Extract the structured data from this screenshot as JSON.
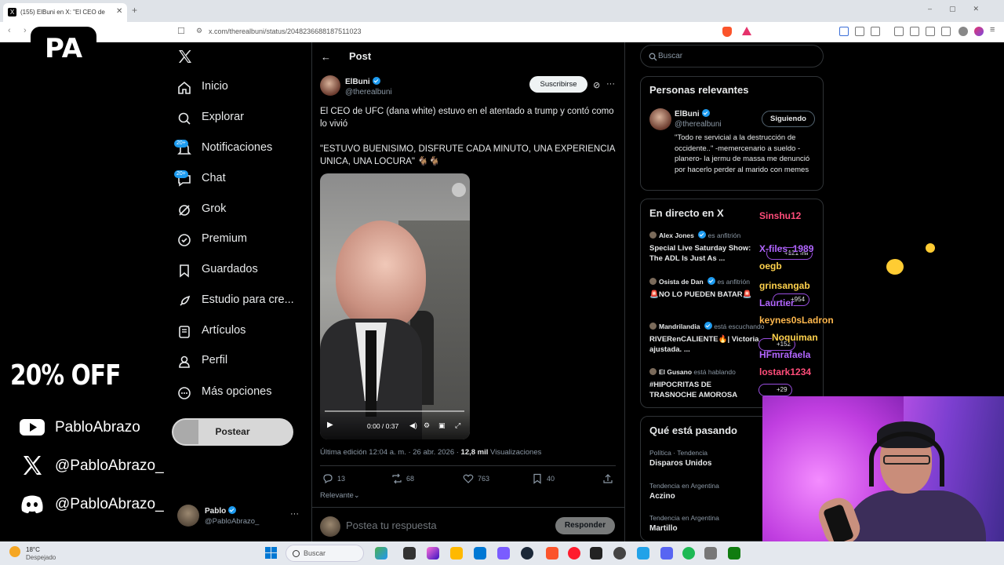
{
  "browser": {
    "tab_title": "(155) ElBuni en X: \"El CEO de U",
    "url": "x.com/therealbuni/status/2048236688187511023"
  },
  "overlay": {
    "logo": "PA",
    "promo": "20% OFF",
    "socials": [
      {
        "icon": "youtube-icon",
        "label": "PabloAbrazo"
      },
      {
        "icon": "x-icon",
        "label": "@PabloAbrazo_"
      },
      {
        "icon": "discord-icon",
        "label": "@PabloAbrazo_"
      }
    ]
  },
  "sidebar": {
    "items": [
      {
        "label": "Inicio",
        "icon": "home-icon"
      },
      {
        "label": "Explorar",
        "icon": "search-icon"
      },
      {
        "label": "Notificaciones",
        "icon": "bell-icon",
        "badge": "20+"
      },
      {
        "label": "Chat",
        "icon": "chat-icon",
        "badge": "20+"
      },
      {
        "label": "Grok",
        "icon": "grok-icon"
      },
      {
        "label": "Premium",
        "icon": "premium-icon"
      },
      {
        "label": "Guardados",
        "icon": "bookmark-icon"
      },
      {
        "label": "Estudio para cre...",
        "icon": "rocket-icon"
      },
      {
        "label": "Artículos",
        "icon": "article-icon"
      },
      {
        "label": "Perfil",
        "icon": "person-icon"
      },
      {
        "label": "Más opciones",
        "icon": "more-icon"
      }
    ],
    "post_button": "Postear",
    "profile": {
      "name": "Pablo",
      "handle": "@PabloAbrazo_",
      "more": "···"
    }
  },
  "post": {
    "header": "Post",
    "author_name": "ElBuni",
    "author_handle": "@therealbuni",
    "subscribe": "Suscribirse",
    "text1": "El CEO de UFC (dana white) estuvo en el atentado a trump y contó como lo vivió",
    "text2": "\"ESTUVO BUENISIMO, DISFRUTE CADA MINUTO, UNA EXPERIENCIA UNICA, UNA LOCURA\" 🐐🐐",
    "video_time": "0:00 / 0:37",
    "meta_prefix": "Última edición 12:04 a. m. · 26 abr. 2026 · ",
    "views": "12,8 mil",
    "views_label": " Visualizaciones",
    "actions": {
      "replies": "13",
      "reposts": "68",
      "likes": "763",
      "bookmarks": "40"
    },
    "sort": "Relevante",
    "reply_placeholder": "Postea tu respuesta",
    "reply_button": "Responder"
  },
  "right": {
    "search_placeholder": "Buscar",
    "relevant_title": "Personas relevantes",
    "relevant": {
      "name": "ElBuni",
      "handle": "@therealbuni",
      "follow": "Siguiendo",
      "bio": "\"Todo re servicial a la destrucción de occidente..\" -memercenario a sueldo - planero- la jermu de massa me denunció por hacerlo perder al marido con memes"
    },
    "live_title": "En directo en X",
    "live": [
      {
        "host": "Alex Jones",
        "role": "es anfitrión",
        "title": "Special Live Saturday Show: The ADL Is Just As ...",
        "count": "+121 mil"
      },
      {
        "host": "Osista de Dan",
        "role": "es anfitrión",
        "title": "🚨NO LO PUEDEN BATAR🚨",
        "count": "+954"
      },
      {
        "host": "Mandrilandia",
        "role": "está escuchando",
        "title": "RIVERenCALIENTE🔥| Victoria ajustada. ...",
        "count": "+152"
      },
      {
        "host": "El Gusano",
        "role": "está hablando",
        "title": "#HIPOCRITAS DE TRASNOCHE AMOROSA",
        "count": "+29"
      }
    ],
    "trends_title": "Qué está pasando",
    "trends": [
      {
        "category": "Política · Tendencia",
        "name": "Disparos Unidos"
      },
      {
        "category": "Tendencia en Argentina",
        "name": "Aczino"
      },
      {
        "category": "Tendencia en Argentina",
        "name": "Martillo"
      }
    ]
  },
  "chat": [
    {
      "user": "Sinshu12",
      "color": "#ff4d7a"
    },
    {
      "user": "X-files_1989",
      "color": "#b266ff"
    },
    {
      "user": "oegb",
      "color": "#ffd24d"
    },
    {
      "user": "grinsangab",
      "color": "#ffd24d"
    },
    {
      "user": "Laurtier",
      "color": "#b266ff"
    },
    {
      "user": "keynes0sLadron",
      "color": "#ffb84d"
    },
    {
      "user": "Noquiman",
      "color": "#ffd24d"
    },
    {
      "user": "HFmrafaela",
      "color": "#b266ff"
    },
    {
      "user": "lostark1234",
      "color": "#ff4d7a"
    }
  ],
  "taskbar": {
    "temp": "18°C",
    "condition": "Despejado",
    "search": "Buscar"
  }
}
